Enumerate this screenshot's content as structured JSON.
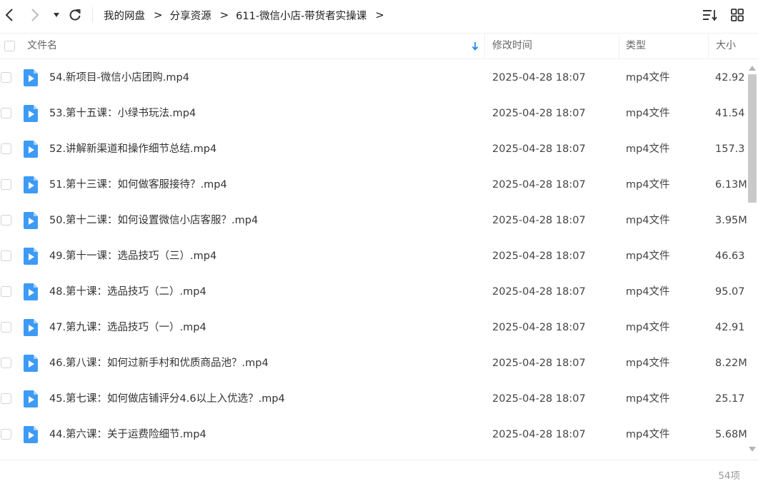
{
  "toolbar": {
    "breadcrumb": [
      "我的网盘",
      "分享资源",
      "611-微信小店-带货者实操课"
    ],
    "arrow": ">"
  },
  "columns": {
    "name": "文件名",
    "time": "修改时间",
    "type": "类型",
    "size": "大小"
  },
  "files": [
    {
      "name": "54.新项目-微信小店团购.mp4",
      "time": "2025-04-28 18:07",
      "type": "mp4文件",
      "size": "42.92"
    },
    {
      "name": "53.第十五课：小绿书玩法.mp4",
      "time": "2025-04-28 18:07",
      "type": "mp4文件",
      "size": "41.54"
    },
    {
      "name": "52.讲解新渠道和操作细节总结.mp4",
      "time": "2025-04-28 18:07",
      "type": "mp4文件",
      "size": "157.3"
    },
    {
      "name": "51.第十三课：如何做客服接待？.mp4",
      "time": "2025-04-28 18:07",
      "type": "mp4文件",
      "size": "6.13M"
    },
    {
      "name": "50.第十二课：如何设置微信小店客服？.mp4",
      "time": "2025-04-28 18:07",
      "type": "mp4文件",
      "size": "3.95M"
    },
    {
      "name": "49.第十一课：选品技巧（三）.mp4",
      "time": "2025-04-28 18:07",
      "type": "mp4文件",
      "size": "46.63"
    },
    {
      "name": "48.第十课：选品技巧（二）.mp4",
      "time": "2025-04-28 18:07",
      "type": "mp4文件",
      "size": "95.07"
    },
    {
      "name": "47.第九课：选品技巧（一）.mp4",
      "time": "2025-04-28 18:07",
      "type": "mp4文件",
      "size": "42.91"
    },
    {
      "name": "46.第八课：如何过新手村和优质商品池？.mp4",
      "time": "2025-04-28 18:07",
      "type": "mp4文件",
      "size": "8.22M"
    },
    {
      "name": "45.第七课：如何做店铺评分4.6以上入优选？.mp4",
      "time": "2025-04-28 18:07",
      "type": "mp4文件",
      "size": "25.17"
    },
    {
      "name": "44.第六课：关于运费险细节.mp4",
      "time": "2025-04-28 18:07",
      "type": "mp4文件",
      "size": "5.68M"
    }
  ],
  "footer": {
    "count": "54项"
  },
  "colors": {
    "accent": "#1e8cf0",
    "icon_blue": "#3d9bf5"
  },
  "icons": {
    "back": "chevron-left-icon",
    "forward": "chevron-right-icon",
    "history": "caret-down-icon",
    "refresh": "refresh-icon",
    "sort": "sort-list-icon",
    "grid": "grid-view-icon",
    "file": "video-file-icon",
    "sort_arrow": "arrow-down-icon"
  }
}
